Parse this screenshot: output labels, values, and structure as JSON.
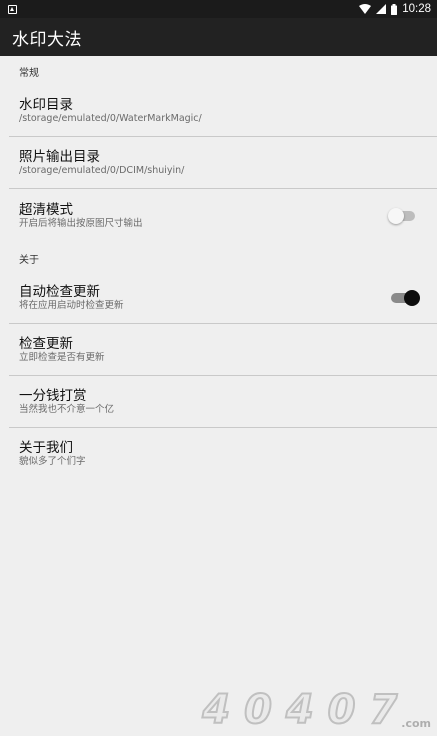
{
  "status_bar": {
    "time": "10:28",
    "icons": [
      "notification-a-icon",
      "wifi-icon",
      "signal-icon",
      "battery-icon"
    ]
  },
  "toolbar": {
    "title": "水印大法"
  },
  "categories": [
    {
      "header": "常规",
      "items": [
        {
          "title": "水印目录",
          "summary": "/storage/emulated/0/WaterMarkMagic/"
        },
        {
          "title": "照片输出目录",
          "summary": "/storage/emulated/0/DCIM/shuiyin/"
        },
        {
          "title": "超清模式",
          "summary": "开启后将输出按原图尺寸输出",
          "switch": "off"
        }
      ]
    },
    {
      "header": "关于",
      "items": [
        {
          "title": "自动检查更新",
          "summary": "将在应用启动时检查更新",
          "switch": "on"
        },
        {
          "title": "检查更新",
          "summary": "立即检查是否有更新"
        },
        {
          "title": "一分钱打赏",
          "summary": "当然我也不介意一个亿"
        },
        {
          "title": "关于我们",
          "summary": "貌似多了个们字"
        }
      ]
    }
  ],
  "watermark": {
    "text": "4 0 4 0 7",
    "suffix": ".com"
  },
  "colors": {
    "status_bar": "#1b1b1b",
    "toolbar": "#222222",
    "background": "#efefef",
    "divider": "#c9c9c9"
  }
}
